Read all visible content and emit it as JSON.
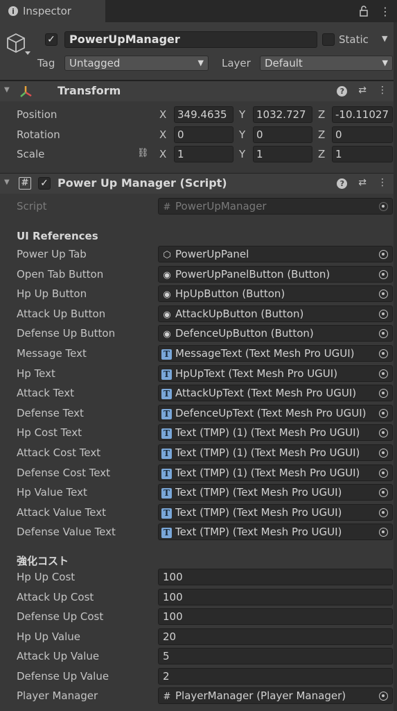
{
  "tab": {
    "title": "Inspector"
  },
  "header": {
    "object_name": "PowerUpManager",
    "static_label": "Static",
    "tag_label": "Tag",
    "tag_value": "Untagged",
    "layer_label": "Layer",
    "layer_value": "Default"
  },
  "transform": {
    "title": "Transform",
    "position_label": "Position",
    "rotation_label": "Rotation",
    "scale_label": "Scale",
    "axis_x": "X",
    "axis_y": "Y",
    "axis_z": "Z",
    "position": {
      "x": "349.4635",
      "y": "1032.727",
      "z": "-10.11027"
    },
    "rotation": {
      "x": "0",
      "y": "0",
      "z": "0"
    },
    "scale": {
      "x": "1",
      "y": "1",
      "z": "1"
    }
  },
  "script_component": {
    "title": "Power Up Manager (Script)",
    "script_label": "Script",
    "script_value": "PowerUpManager",
    "ui_references_header": "UI References",
    "fields": [
      {
        "label": "Power Up Tab",
        "value": "PowerUpPanel",
        "icon": "cube-icon"
      },
      {
        "label": "Open Tab Button",
        "value": "PowerUpPanelButton (Button)",
        "icon": "button-icon"
      },
      {
        "label": "Hp Up Button",
        "value": "HpUpButton (Button)",
        "icon": "button-icon"
      },
      {
        "label": "Attack Up Button",
        "value": "AttackUpButton (Button)",
        "icon": "button-icon"
      },
      {
        "label": "Defense Up Button",
        "value": "DefenceUpButton (Button)",
        "icon": "button-icon"
      },
      {
        "label": "Message Text",
        "value": "MessageText (Text Mesh Pro UGUI)",
        "icon": "tmp-icon"
      },
      {
        "label": "Hp Text",
        "value": "HpUpText (Text Mesh Pro UGUI)",
        "icon": "tmp-icon"
      },
      {
        "label": "Attack Text",
        "value": "AttackUpText (Text Mesh Pro UGUI)",
        "icon": "tmp-icon"
      },
      {
        "label": "Defense Text",
        "value": "DefenceUpText (Text Mesh Pro UGUI)",
        "icon": "tmp-icon"
      },
      {
        "label": "Hp Cost Text",
        "value": "Text (TMP) (1) (Text Mesh Pro UGUI)",
        "icon": "tmp-icon"
      },
      {
        "label": "Attack Cost Text",
        "value": "Text (TMP) (1) (Text Mesh Pro UGUI)",
        "icon": "tmp-icon"
      },
      {
        "label": "Defense Cost Text",
        "value": "Text (TMP) (1) (Text Mesh Pro UGUI)",
        "icon": "tmp-icon"
      },
      {
        "label": "Hp Value Text",
        "value": "Text (TMP) (Text Mesh Pro UGUI)",
        "icon": "tmp-icon"
      },
      {
        "label": "Attack Value Text",
        "value": "Text (TMP) (Text Mesh Pro UGUI)",
        "icon": "tmp-icon"
      },
      {
        "label": "Defense Value Text",
        "value": "Text (TMP) (Text Mesh Pro UGUI)",
        "icon": "tmp-icon"
      }
    ],
    "cost_header": "強化コスト",
    "values": [
      {
        "label": "Hp Up Cost",
        "value": "100"
      },
      {
        "label": "Attack Up Cost",
        "value": "100"
      },
      {
        "label": "Defense Up Cost",
        "value": "100"
      },
      {
        "label": "Hp Up Value",
        "value": "20"
      },
      {
        "label": "Attack Up Value",
        "value": "5"
      },
      {
        "label": "Defense Up Value",
        "value": "2"
      }
    ],
    "player_manager_label": "Player Manager",
    "player_manager_value": "PlayerManager (Player Manager)"
  },
  "colors": {
    "background": "#383838",
    "field": "#2a2a2a",
    "tmp_icon": "#7aa7d8",
    "transform_accent": "#e8a33a"
  }
}
